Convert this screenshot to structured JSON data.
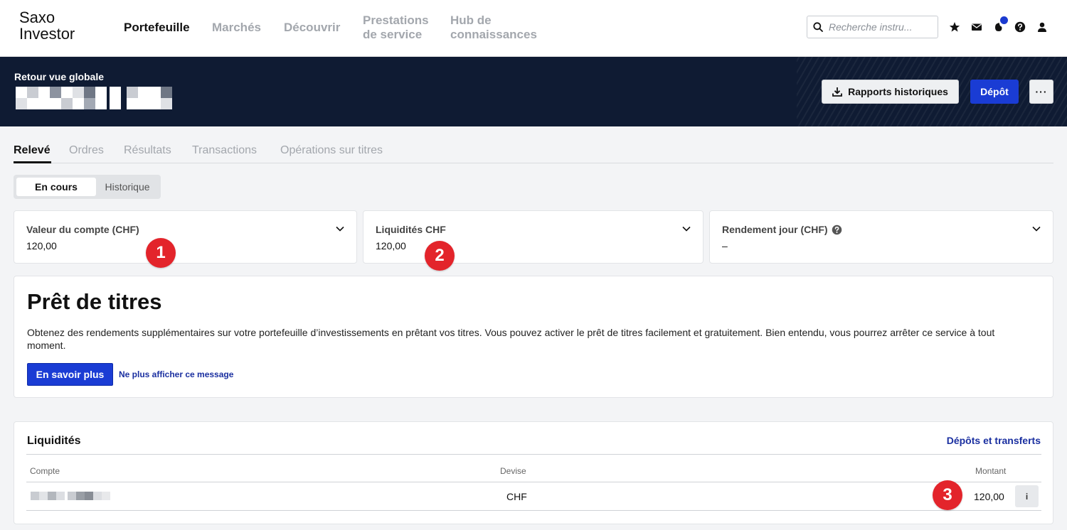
{
  "brand": {
    "line1": "Saxo",
    "line2": "Investor"
  },
  "nav": {
    "portfolio": "Portefeuille",
    "markets": "Marchés",
    "discover": "Découvrir",
    "services_line1": "Prestations",
    "services_line2": "de service",
    "hub_line1": "Hub de",
    "hub_line2": "connaissances"
  },
  "search": {
    "placeholder": "Recherche instru..."
  },
  "top_icons": [
    "star-icon",
    "mail-icon",
    "notification-icon",
    "help-icon",
    "user-icon"
  ],
  "header": {
    "back_label": "Retour vue globale",
    "reports_label": "Rapports historiques",
    "deposit_label": "Dépôt",
    "more_label": "···"
  },
  "tabs": {
    "statement": "Relevé",
    "orders": "Ordres",
    "results": "Résultats",
    "transactions": "Transactions",
    "corporate_actions": "Opérations sur titres"
  },
  "segment": {
    "current": "En cours",
    "history": "Historique"
  },
  "summary": {
    "account_value": {
      "title": "Valeur du compte (CHF)",
      "value": "120,00"
    },
    "cash": {
      "title": "Liquidités CHF",
      "value": "120,00"
    },
    "daily_return": {
      "title": "Rendement jour (CHF)",
      "value": "–"
    }
  },
  "badges": {
    "one": "1",
    "two": "2",
    "three": "3"
  },
  "promo": {
    "title": "Prêt de titres",
    "text": "Obtenez des rendements supplémentaires sur votre portefeuille d’investissements en prêtant vos titres. Vous pouvez activer le prêt de titres facilement et gratuitement. Bien entendu, vous pourrez arrêter ce service à tout moment.",
    "learn_more": "En savoir plus",
    "dismiss": "Ne plus afficher ce message"
  },
  "liquidity": {
    "title": "Liquidités",
    "link": "Dépôts et transferts",
    "columns": {
      "account": "Compte",
      "currency": "Devise",
      "amount": "Montant"
    },
    "rows": [
      {
        "currency": "CHF",
        "amount": "120,00"
      }
    ],
    "info_label": "i"
  },
  "colors": {
    "accent": "#1a3cd4",
    "header_bg": "#0f1b33",
    "badge": "#e3242b",
    "link": "#1a2fa0"
  }
}
